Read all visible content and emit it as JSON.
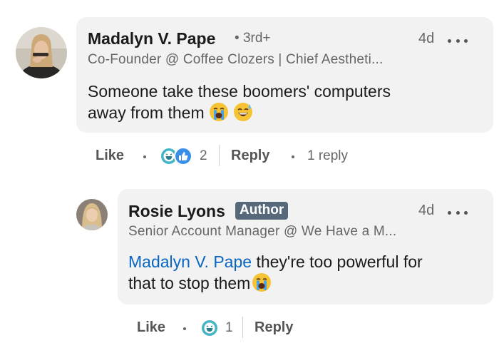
{
  "comment": {
    "author_name": "Madalyn V. Pape",
    "degree": "3rd+",
    "time": "4d",
    "headline": "Co-Founder @ Coffee Clozers | Chief Aestheti...",
    "text_line1": "Someone take these boomers' computers",
    "text_line2": "away from them",
    "emojis": [
      "loudly-crying-face",
      "grinning-face-with-sweat"
    ],
    "actions": {
      "like_label": "Like",
      "reaction_count": "2",
      "reply_label": "Reply",
      "replies_label": "1 reply"
    },
    "reaction_icons": [
      "funny-icon",
      "like-icon"
    ]
  },
  "reply": {
    "author_name": "Rosie Lyons",
    "badge": "Author",
    "time": "4d",
    "headline": "Senior Account Manager @ We Have a M...",
    "mention": "Madalyn V. Pape",
    "text_line1_rest": " they're too powerful for",
    "text_line2": "that to stop them",
    "emojis": [
      "loudly-crying-face"
    ],
    "actions": {
      "like_label": "Like",
      "reaction_count": "1",
      "reply_label": "Reply"
    },
    "reaction_icons": [
      "funny-icon"
    ]
  },
  "colors": {
    "mention": "#0a66c2",
    "bubble": "#f2f2f2",
    "author_badge": "#56687a",
    "like_reaction": "#378fe9",
    "funny_reaction": "#44b5c4"
  }
}
